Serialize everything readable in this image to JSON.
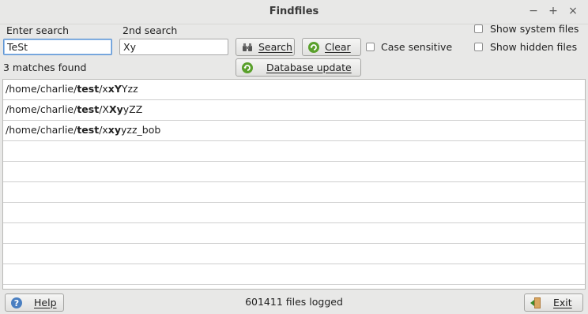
{
  "window": {
    "title": "Findfiles",
    "controls": [
      "minimize-icon",
      "maximize-icon",
      "close-icon"
    ],
    "minimize_glyph": "−",
    "maximize_glyph": "+",
    "close_glyph": "×"
  },
  "search": {
    "label1": "Enter search",
    "value1": "TeSt",
    "label2": "2nd search",
    "value2": "Xy"
  },
  "buttons": {
    "search": "Search",
    "clear": "Clear",
    "database_update": "Database update",
    "help": "Help",
    "exit": "Exit"
  },
  "options": {
    "case_sensitive": {
      "label": "Case sensitive",
      "checked": false
    },
    "show_system_files": {
      "label": "Show system files",
      "checked": false
    },
    "show_hidden_files": {
      "label": "Show hidden files",
      "checked": false
    }
  },
  "status": {
    "matches": "3 matches found",
    "files_logged": "601411 files logged"
  },
  "results": [
    {
      "parts": [
        {
          "t": "/home/charlie/",
          "b": false
        },
        {
          "t": "test",
          "b": true
        },
        {
          "t": "/x",
          "b": false
        },
        {
          "t": "xY",
          "b": true
        },
        {
          "t": "Yzz",
          "b": false
        }
      ]
    },
    {
      "parts": [
        {
          "t": "/home/charlie/",
          "b": false
        },
        {
          "t": "test",
          "b": true
        },
        {
          "t": "/X",
          "b": false
        },
        {
          "t": "Xy",
          "b": true
        },
        {
          "t": "yZZ",
          "b": false
        }
      ]
    },
    {
      "parts": [
        {
          "t": "/home/charlie/",
          "b": false
        },
        {
          "t": "test",
          "b": true
        },
        {
          "t": "/x",
          "b": false
        },
        {
          "t": "xy",
          "b": true
        },
        {
          "t": "yzz_bob",
          "b": false
        }
      ]
    }
  ],
  "colors": {
    "window_bg": "#e8e8e7",
    "focus_border": "#5b93d3",
    "list_bg": "#ffffff"
  }
}
